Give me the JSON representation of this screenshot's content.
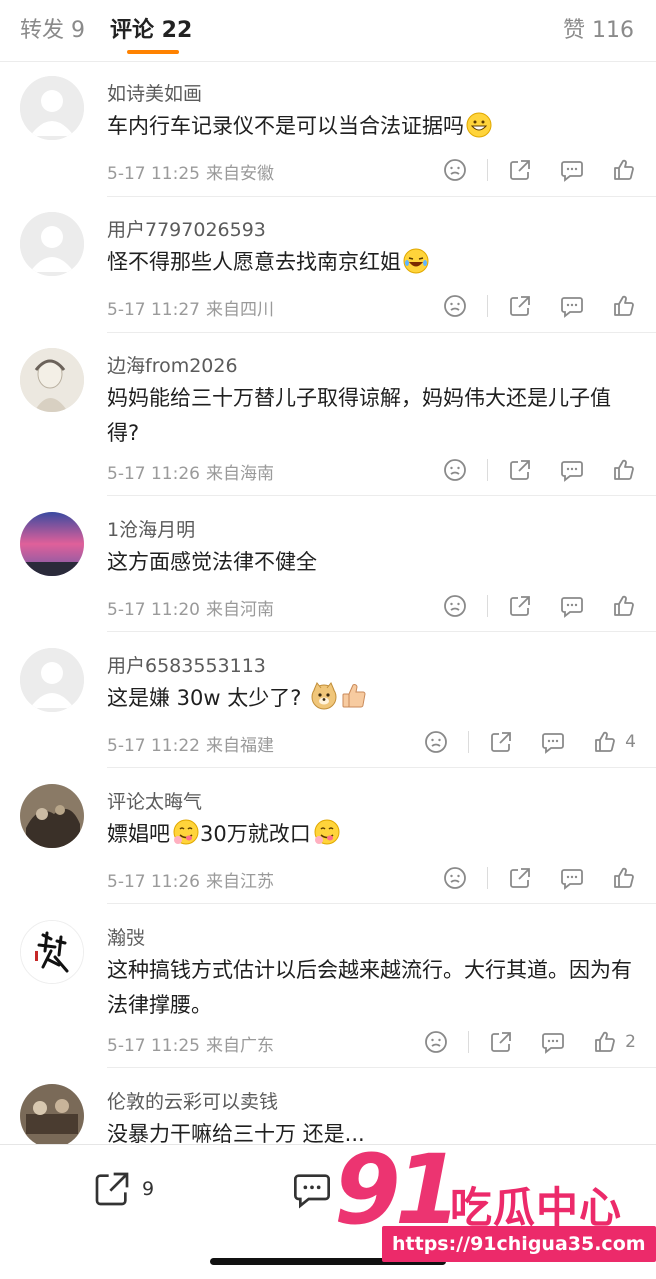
{
  "tabs": {
    "repost": "转发 9",
    "comment": "评论 22",
    "like": "赞 116"
  },
  "accent_color": "#ff8200",
  "comments": [
    {
      "name": "如诗美如画",
      "text": "车内行车记录仪不是可以当合法证据吗",
      "emoji": "grinning-face",
      "time": "5-17 11:25",
      "place": "来自安徽",
      "likes": ""
    },
    {
      "name": "用户7797026593",
      "text": "怪不得那些人愿意去找南京红姐",
      "emoji": "laughing-tears-face",
      "time": "5-17 11:27",
      "place": "来自四川",
      "likes": ""
    },
    {
      "name": "边海from2026",
      "text": "妈妈能给三十万替儿子取得谅解，妈妈伟大还是儿子值得?",
      "time": "5-17 11:26",
      "place": "来自海南",
      "likes": ""
    },
    {
      "name": "1沧海月明",
      "text": "这方面感觉法律不健全",
      "time": "5-17 11:20",
      "place": "来自河南",
      "likes": ""
    },
    {
      "name": "用户6583553113",
      "text": "这是嫌 30w 太少了?",
      "emoji": "doge-and-thumbs-up",
      "time": "5-17 11:22",
      "place": "来自福建",
      "likes": "4"
    },
    {
      "name": "评论太晦气",
      "text_a": "嫖娼吧",
      "text_b": "30万就改口",
      "emoji": "yum-face",
      "time": "5-17 11:26",
      "place": "来自江苏",
      "likes": ""
    },
    {
      "name": "瀚弢",
      "text": "这种搞钱方式估计以后会越来越流行。大行其道。因为有法律撑腰。",
      "time": "5-17 11:25",
      "place": "来自广东",
      "likes": "2"
    },
    {
      "name": "伦敦的云彩可以卖钱",
      "text": "没暴力干嘛给三十万 还是..."
    }
  ],
  "bottom": {
    "repost_count": "9"
  },
  "watermark": {
    "number": "91",
    "name": "吃瓜中心",
    "url": "https://91chigua35.com"
  },
  "watermark_color": "#ec2a6a"
}
